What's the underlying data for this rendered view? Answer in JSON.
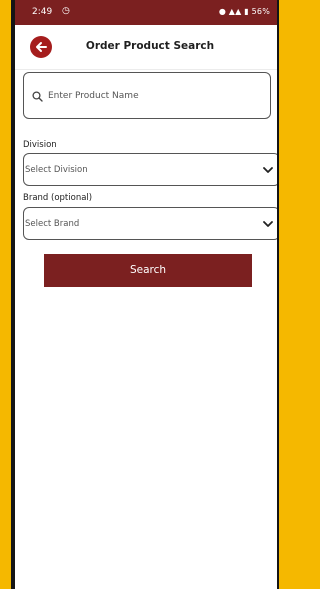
{
  "status": {
    "time": "2:49",
    "right_text": "56%"
  },
  "header": {
    "title": "Order Product Search"
  },
  "search": {
    "placeholder": "Enter Product Name"
  },
  "division": {
    "label": "Division",
    "selected": "Select Division"
  },
  "brand": {
    "label": "Brand (optional)",
    "selected": "Select Brand"
  },
  "actions": {
    "search_label": "Search"
  },
  "colors": {
    "accent": "#7b2020",
    "back_button": "#a51d1d",
    "frame": "#f5b800"
  }
}
